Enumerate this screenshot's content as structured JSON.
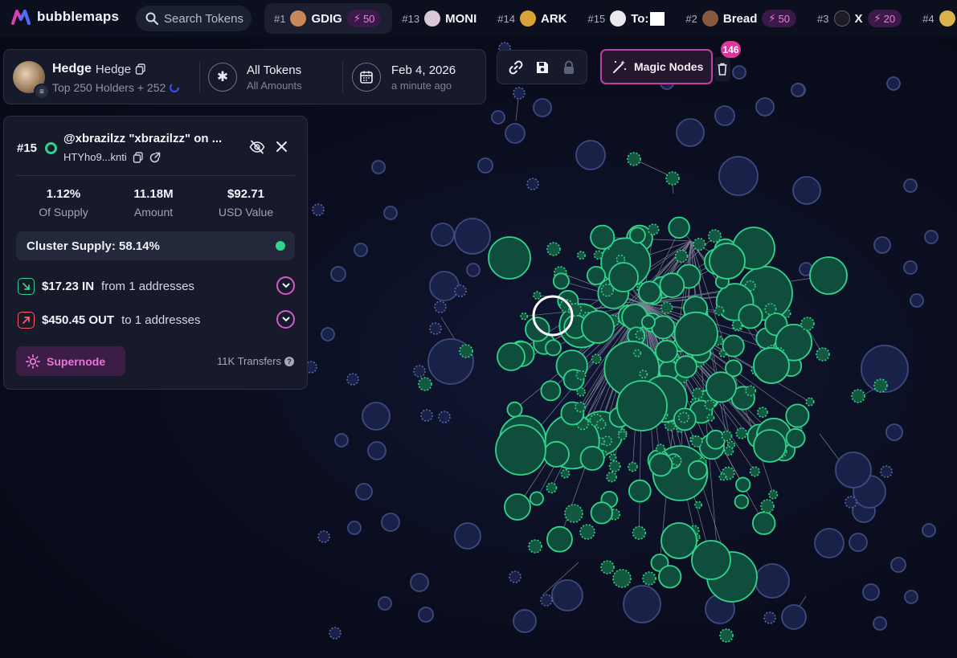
{
  "brand": {
    "name": "bubblemaps"
  },
  "search": {
    "placeholder": "Search Tokens"
  },
  "ticker": [
    {
      "rank": "#1",
      "name": "GDIG",
      "boost": "50",
      "avatar": "#c9875a"
    },
    {
      "rank": "#13",
      "name": "MONI",
      "boost": null,
      "avatar": "#d9c9d6"
    },
    {
      "rank": "#14",
      "name": "ARK",
      "boost": null,
      "avatar": "#d9a238"
    },
    {
      "rank": "#15",
      "name": "To:",
      "boost": null,
      "avatar": "#e9e9ee"
    },
    {
      "rank": "#2",
      "name": "Bread",
      "boost": "50",
      "avatar": "#8a5a3e"
    },
    {
      "rank": "#3",
      "name": "X",
      "boost": "20",
      "avatar": "#1c1c22"
    },
    {
      "rank": "#4",
      "name": "",
      "boost": null,
      "avatar": "#d9b44a"
    }
  ],
  "wallet": {
    "name": "Hedge",
    "symbol": "Hedge",
    "holders": "Top 250 Holders + 252",
    "token_filter": "All Tokens",
    "amount_filter": "All Amounts",
    "date": "Feb 4, 2026",
    "updated": "a minute ago"
  },
  "toolbar": {
    "magic_nodes": "Magic Nodes",
    "magic_count": "146"
  },
  "node": {
    "rank": "#15",
    "title": "@xbrazilzz \"xbrazilzz\" on ...",
    "address": "HTYho9...knti",
    "supply_pct": "1.12%",
    "supply_label": "Of Supply",
    "amount": "11.18M",
    "amount_label": "Amount",
    "usd": "$92.71",
    "usd_label": "USD Value",
    "cluster_supply": "Cluster Supply: 58.14%",
    "in_amount": "$17.23 IN",
    "in_text": "from 1 addresses",
    "out_amount": "$450.45 OUT",
    "out_text": "to 1 addresses",
    "supernode": "Supernode",
    "transfers": "11K Transfers"
  },
  "colors": {
    "cluster_green": "#2fd58c",
    "cluster_fill": "#0f4d3c",
    "neutral_bubble": "#24305a",
    "accent_pink": "#d940b3",
    "in_green": "#2fd58c",
    "out_red": "#ff5b62"
  },
  "icons": [
    "search-icon",
    "copy-icon",
    "external-link-icon",
    "calendar-icon",
    "asterisk-icon",
    "link-icon",
    "save-icon",
    "lock-icon",
    "magic-wand-icon",
    "trash-icon",
    "eye-off-icon",
    "close-icon",
    "arrow-in-icon",
    "arrow-out-icon",
    "chevron-down-icon",
    "sun-icon",
    "help-icon",
    "spinner-icon"
  ]
}
